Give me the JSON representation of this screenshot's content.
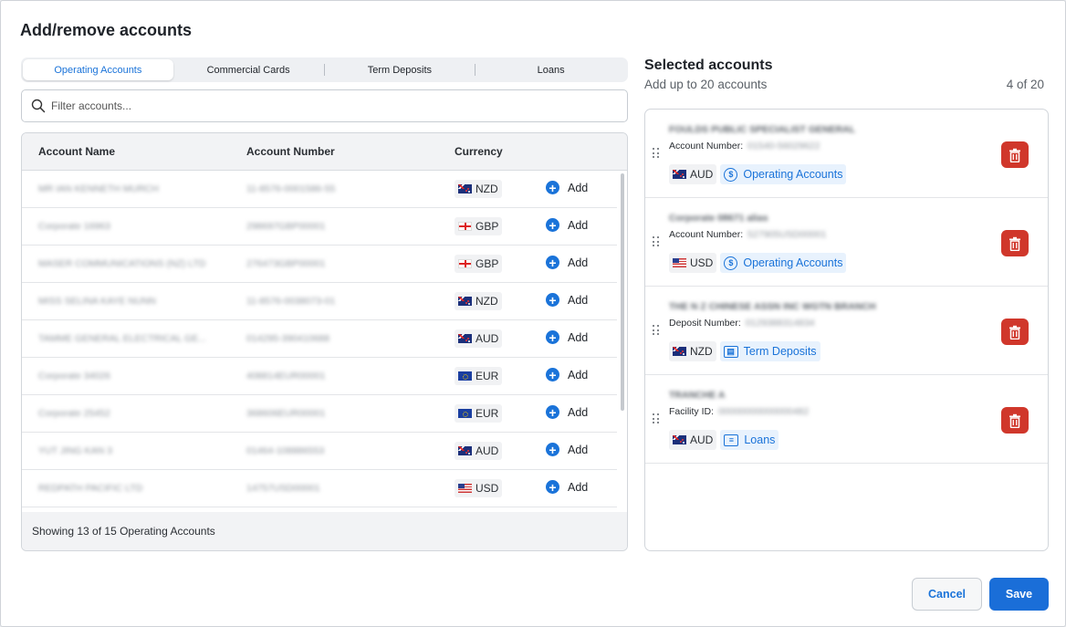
{
  "dialog": {
    "title": "Add/remove accounts"
  },
  "tabs": [
    {
      "label": "Operating Accounts",
      "active": true
    },
    {
      "label": "Commercial Cards",
      "active": false
    },
    {
      "label": "Term Deposits",
      "active": false
    },
    {
      "label": "Loans",
      "active": false
    }
  ],
  "search": {
    "placeholder": "Filter accounts...",
    "icon": "search-icon"
  },
  "table": {
    "headers": {
      "name": "Account Name",
      "number": "Account Number",
      "currency": "Currency"
    },
    "add_label": "Add",
    "rows": [
      {
        "name": "MR IAN KENNETH MURCH",
        "number": "11-8576-0001586-55",
        "currency": "NZD"
      },
      {
        "name": "Corporate 16963",
        "number": "298697GBP00001",
        "currency": "GBP"
      },
      {
        "name": "MASER COMMUNICATIONS (NZ) LTD",
        "number": "276473GBP00001",
        "currency": "GBP"
      },
      {
        "name": "MISS SELINA KAYE NUNN",
        "number": "11-8576-0038073-01",
        "currency": "NZD"
      },
      {
        "name": "TAMME GENERAL ELECTRICAL GE...",
        "number": "014295-390410688",
        "currency": "AUD"
      },
      {
        "name": "Corporate 34026",
        "number": "408814EUR00001",
        "currency": "EUR"
      },
      {
        "name": "Corporate 25452",
        "number": "368606EUR00001",
        "currency": "EUR"
      },
      {
        "name": "YUT JING KAN 3",
        "number": "01464-108886553",
        "currency": "AUD"
      },
      {
        "name": "REDPATH PACIFIC LTD",
        "number": "14757USD00001",
        "currency": "USD"
      }
    ],
    "footer": "Showing 13 of 15 Operating Accounts"
  },
  "selected": {
    "title": "Selected accounts",
    "subtitle": "Add up to 20 accounts",
    "count": "4 of 20",
    "cards": [
      {
        "name": "FOULDS PUBLIC SPECIALIST GENERAL",
        "id_label": "Account Number:",
        "id_value": "01540-56029622",
        "currency": "AUD",
        "type": "Operating Accounts",
        "type_icon": "dollar-circle-icon"
      },
      {
        "name": "Corporate 08671 alias",
        "id_label": "Account Number:",
        "id_value": "527905USD00001",
        "currency": "USD",
        "type": "Operating Accounts",
        "type_icon": "dollar-circle-icon"
      },
      {
        "name": "THE N Z CHINESE ASSN INC WGTN BRANCH",
        "id_label": "Deposit Number:",
        "id_value": "0129388314834",
        "currency": "NZD",
        "type": "Term Deposits",
        "type_icon": "term-deposit-icon"
      },
      {
        "name": "TRANCHE A",
        "id_label": "Facility ID:",
        "id_value": "00000000000000482",
        "currency": "AUD",
        "type": "Loans",
        "type_icon": "loan-icon"
      }
    ]
  },
  "buttons": {
    "cancel": "Cancel",
    "save": "Save"
  },
  "colors": {
    "accent": "#1a73d9",
    "danger": "#d0372b",
    "save_bg": "#1a6ed8"
  }
}
